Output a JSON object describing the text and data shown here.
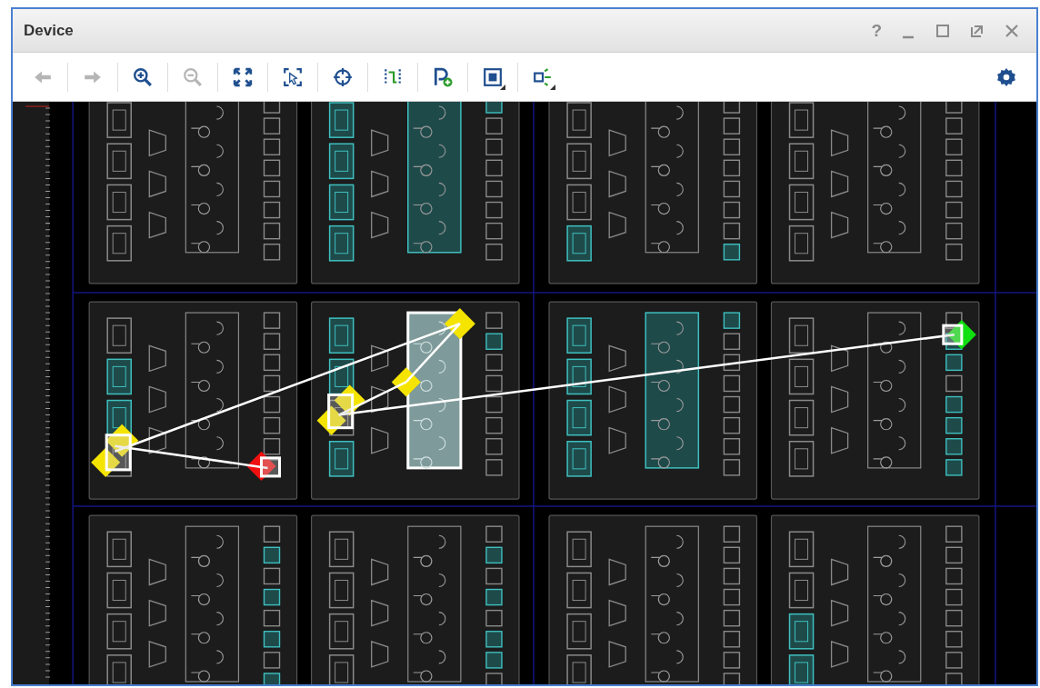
{
  "window": {
    "title": "Device",
    "help": "?"
  },
  "toolbar": [
    {
      "kind": "back",
      "disabled": true
    },
    {
      "kind": "forward",
      "disabled": true
    },
    {
      "kind": "zoom-in",
      "disabled": false
    },
    {
      "kind": "zoom-out",
      "disabled": true
    },
    {
      "kind": "fit",
      "disabled": false
    },
    {
      "kind": "zoom-selection",
      "disabled": false
    },
    {
      "kind": "crosshair",
      "disabled": false
    },
    {
      "kind": "route",
      "disabled": false
    },
    {
      "kind": "add-pblock",
      "disabled": false
    },
    {
      "kind": "layers",
      "disabled": false,
      "has_menu": true
    },
    {
      "kind": "nets",
      "disabled": false,
      "has_menu": true
    }
  ],
  "tiles": [
    {
      "ff": [
        false,
        false,
        false,
        false
      ],
      "carry_placed": false,
      "carry_selected": false,
      "outs": [
        false,
        false,
        false,
        false,
        false,
        false,
        false,
        false
      ]
    },
    {
      "ff": [
        true,
        true,
        true,
        true
      ],
      "carry_placed": true,
      "carry_selected": false,
      "outs": [
        true,
        false,
        false,
        false,
        false,
        false,
        false,
        false
      ]
    },
    {
      "ff": [
        false,
        false,
        false,
        true
      ],
      "carry_placed": false,
      "carry_selected": false,
      "outs": [
        false,
        false,
        false,
        false,
        false,
        false,
        false,
        true
      ]
    },
    {
      "ff": [
        false,
        false,
        false,
        false
      ],
      "carry_placed": false,
      "carry_selected": false,
      "outs": [
        false,
        false,
        false,
        false,
        false,
        false,
        false,
        false
      ]
    },
    {
      "ff": [
        false,
        true,
        true,
        false
      ],
      "carry_placed": false,
      "carry_selected": false,
      "outs": [
        false,
        false,
        false,
        false,
        false,
        false,
        false,
        false
      ]
    },
    {
      "ff": [
        true,
        true,
        false,
        true
      ],
      "carry_placed": false,
      "carry_selected": true,
      "outs": [
        false,
        true,
        false,
        false,
        false,
        false,
        false,
        false
      ]
    },
    {
      "ff": [
        true,
        true,
        true,
        true
      ],
      "carry_placed": true,
      "carry_selected": false,
      "outs": [
        true,
        false,
        false,
        false,
        false,
        false,
        false,
        false
      ]
    },
    {
      "ff": [
        false,
        false,
        false,
        false
      ],
      "carry_placed": false,
      "carry_selected": false,
      "outs": [
        false,
        true,
        true,
        false,
        true,
        true,
        true,
        true
      ]
    },
    {
      "ff": [
        false,
        false,
        false,
        false
      ],
      "carry_placed": false,
      "carry_selected": false,
      "outs": [
        false,
        true,
        false,
        true,
        false,
        true,
        false,
        true
      ]
    },
    {
      "ff": [
        false,
        false,
        false,
        false
      ],
      "carry_placed": false,
      "carry_selected": false,
      "outs": [
        false,
        true,
        false,
        true,
        false,
        true,
        true,
        false
      ]
    },
    {
      "ff": [
        false,
        false,
        false,
        false
      ],
      "carry_placed": false,
      "carry_selected": false,
      "outs": [
        false,
        false,
        false,
        false,
        false,
        false,
        false,
        false
      ]
    },
    {
      "ff": [
        false,
        false,
        true,
        true
      ],
      "carry_placed": false,
      "carry_selected": false,
      "outs": [
        false,
        false,
        false,
        false,
        false,
        false,
        false,
        false
      ]
    }
  ]
}
